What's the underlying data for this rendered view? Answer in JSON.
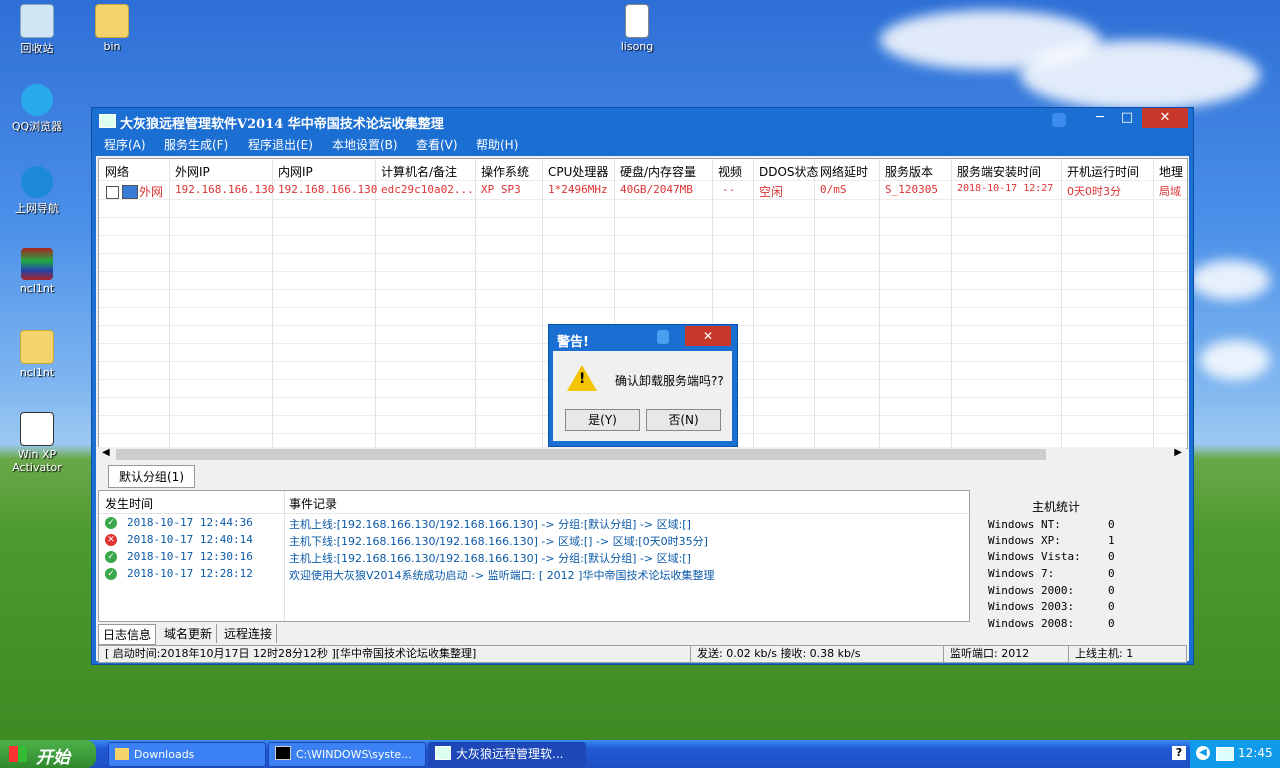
{
  "desktop": {
    "icons": [
      {
        "label": "回收站",
        "icon": "recycle-bin-icon"
      },
      {
        "label": "bin",
        "icon": "folder-icon"
      },
      {
        "label": "lisong",
        "icon": "text-file-icon"
      },
      {
        "label": "QQ浏览器",
        "icon": "qq-browser-icon"
      },
      {
        "label": "上网导航",
        "icon": "ie-browser-icon"
      },
      {
        "label": "ncl1nt",
        "icon": "rar-archive-icon"
      },
      {
        "label": "ncl1nt",
        "icon": "folder-icon"
      },
      {
        "label": "Win XP Activator",
        "icon": "activator-icon"
      }
    ]
  },
  "window": {
    "title": "大灰狼远程管理软件V2014   华中帝国技术论坛收集整理",
    "menu": [
      "程序(A)",
      "服务生成(F)",
      "程序退出(E)",
      "本地设置(B)",
      "查看(V)",
      "帮助(H)"
    ],
    "grid": {
      "headers": [
        "网络",
        "外网IP",
        "内网IP",
        "计算机名/备注",
        "操作系统",
        "CPU处理器",
        "硬盘/内存容量",
        "视频",
        "DDOS状态",
        "网络延时",
        "服务版本",
        "服务端安装时间",
        "开机运行时间",
        "地理"
      ],
      "rows": [
        [
          "外网",
          "192.168.166.130",
          "192.168.166.130",
          "edc29c10a02...",
          "XP SP3",
          "1*2496MHz",
          "40GB/2047MB",
          "--",
          "空闲",
          "0/mS",
          "S_120305",
          "2018-10-17 12:27",
          "0天0时3分",
          "局域"
        ]
      ]
    },
    "group_tab": "默认分组(1)",
    "log": {
      "headers": [
        "发生时间",
        "事件记录"
      ],
      "rows": [
        {
          "time": "2018-10-17 12:44:36",
          "text": "主机上线:[192.168.166.130/192.168.166.130] -> 分组:[默认分组] -> 区域:[]",
          "status": "ok"
        },
        {
          "time": "2018-10-17 12:40:14",
          "text": "主机下线:[192.168.166.130/192.168.166.130] -> 区域:[] -> 区域:[0天0时35分]",
          "status": "error"
        },
        {
          "time": "2018-10-17 12:30:16",
          "text": "主机上线:[192.168.166.130/192.168.166.130] -> 分组:[默认分组] -> 区域:[]",
          "status": "ok"
        },
        {
          "time": "2018-10-17 12:28:12",
          "text": "欢迎使用大灰狼V2014系统成功启动 -> 监听端口: [ 2012 ]华中帝国技术论坛收集整理",
          "status": "ok"
        }
      ]
    },
    "stats": {
      "title": "主机统计",
      "rows": [
        {
          "name": "Windows NT:",
          "value": "0"
        },
        {
          "name": "Windows XP:",
          "value": "1"
        },
        {
          "name": "Windows Vista:",
          "value": "0"
        },
        {
          "name": "Windows 7:",
          "value": "0"
        },
        {
          "name": "Windows 2000:",
          "value": "0"
        },
        {
          "name": "Windows 2003:",
          "value": "0"
        },
        {
          "name": "Windows 2008:",
          "value": "0"
        }
      ]
    },
    "bottom_tabs": [
      "日志信息",
      "域名更新",
      "远程连接"
    ],
    "status": {
      "start_time": "[ 启动时间:2018年10月17日 12时28分12秒 ][华中帝国技术论坛收集整理]",
      "speed": "发送: 0.02 kb/s 接收: 0.38 kb/s",
      "port": "监听端口: 2012",
      "online": "上线主机: 1"
    }
  },
  "dialog": {
    "title": "警告!",
    "message": "确认卸载服务端吗??",
    "yes": "是(Y)",
    "no": "否(N)"
  },
  "taskbar": {
    "start": "开始",
    "tasks": [
      "Downloads",
      "C:\\WINDOWS\\syste...",
      "大灰狼远程管理软..."
    ],
    "clock": "12:45"
  },
  "colors": {
    "window_blue": "#1c6fd2",
    "close_red": "#c8382a",
    "row_text": "#dd3333",
    "log_text": "#0b5aa8"
  }
}
